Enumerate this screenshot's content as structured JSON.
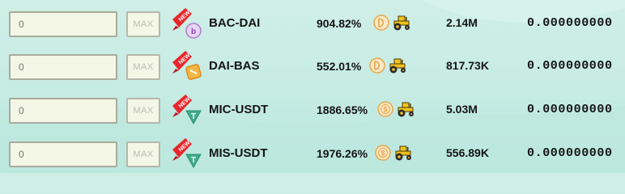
{
  "pools": [
    {
      "amount_placeholder": "0",
      "max_label": "MAX",
      "pair": "BAC-DAI",
      "apy": "904.82%",
      "coin_icon": "dai-coin-icon",
      "tvl": "2.14M",
      "earned": "0.000000000",
      "token_color": "#e6d6f0",
      "token_mark": "b"
    },
    {
      "amount_placeholder": "0",
      "max_label": "MAX",
      "pair": "DAI-BAS",
      "apy": "552.01%",
      "coin_icon": "dai-coin-icon",
      "tvl": "817.73K",
      "earned": "0.000000000",
      "token_color": "#f2b845",
      "token_mark": ""
    },
    {
      "amount_placeholder": "0",
      "max_label": "MAX",
      "pair": "MIC-USDT",
      "apy": "1886.65%",
      "coin_icon": "usdc-coin-icon",
      "tvl": "5.03M",
      "earned": "0.000000000",
      "token_color": "#3fae8c",
      "token_mark": "T"
    },
    {
      "amount_placeholder": "0",
      "max_label": "MAX",
      "pair": "MIS-USDT",
      "apy": "1976.26%",
      "coin_icon": "usdc-coin-icon",
      "tvl": "556.89K",
      "earned": "0.000000000",
      "token_color": "#3fae8c",
      "token_mark": "T"
    }
  ],
  "new_badge": "NEW",
  "colors": {
    "background": "#c7ece4",
    "input_bg": "#f4f7e6",
    "input_border": "#a9ab9c",
    "badge_red": "#e8262b",
    "tractor_yellow": "#f2c21b"
  }
}
